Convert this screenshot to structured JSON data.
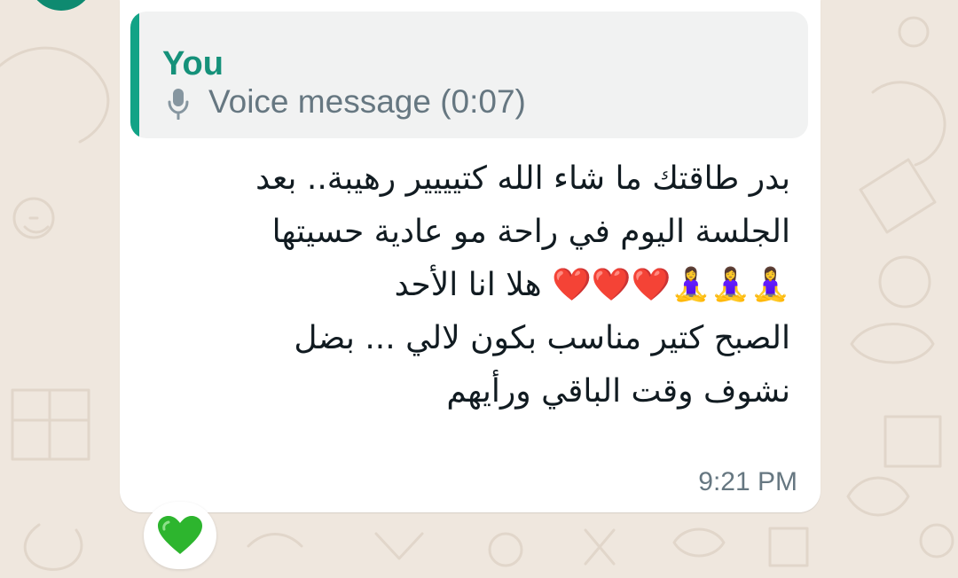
{
  "chat": {
    "quoted_reply": {
      "author": "You",
      "icon": "microphone-icon",
      "text": "Voice message (0:07)"
    },
    "message": {
      "lines": [
        "بدر طاقتك ما شاء الله كتيييير رهيبة.. بعد",
        "الجلسة اليوم في راحة مو عادية حسيتها",
        "🧘‍♀️🧘‍♀️🧘‍♀️❤️❤️❤️ هلا انا الأحد",
        "الصبح كتير مناسب بكون لالي ... بضل",
        "نشوف وقت الباقي ورأيهم"
      ],
      "timestamp": "9:21 PM"
    },
    "reaction": {
      "emoji": "💚",
      "icon": "green-heart-icon"
    }
  },
  "colors": {
    "wallpaper": "#efe7de",
    "bubble": "#ffffff",
    "quote_background": "#f1f2f2",
    "accent_green": "#12a386",
    "muted_text": "#667781",
    "message_text": "#111b21",
    "heart_red": "#e5252a",
    "heart_green": "#2db52e"
  }
}
